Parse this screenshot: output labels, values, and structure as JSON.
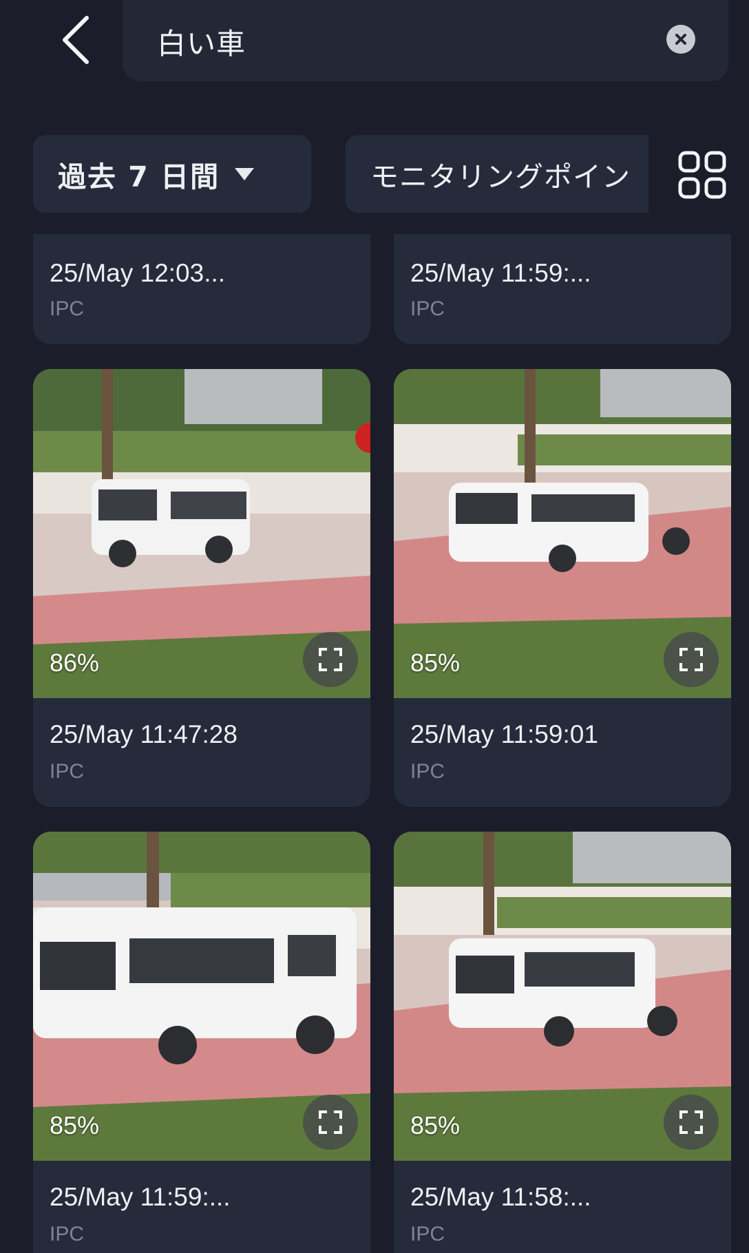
{
  "header": {
    "search_value": "白い車",
    "back_icon": "chevron-left-icon",
    "clear_icon": "close-circle-icon"
  },
  "filters": {
    "time_range": "過去 7 日間",
    "monitoring_point": "モニタリングポイン",
    "view_toggle_icon": "grid-view-icon"
  },
  "results": [
    {
      "time": "25/May 12:03...",
      "source": "IPC",
      "score": null
    },
    {
      "time": "25/May 11:59:...",
      "source": "IPC",
      "score": null
    },
    {
      "time": "25/May 11:47:28",
      "source": "IPC",
      "score": "86%"
    },
    {
      "time": "25/May 11:59:01",
      "source": "IPC",
      "score": "85%"
    },
    {
      "time": "25/May 11:59:...",
      "source": "IPC",
      "score": "85%"
    },
    {
      "time": "25/May 11:58:...",
      "source": "IPC",
      "score": "85%"
    }
  ],
  "colors": {
    "background": "#1b1e2a",
    "card": "#262b3b",
    "text_primary": "#eef0f4",
    "text_secondary": "#7f8494"
  }
}
